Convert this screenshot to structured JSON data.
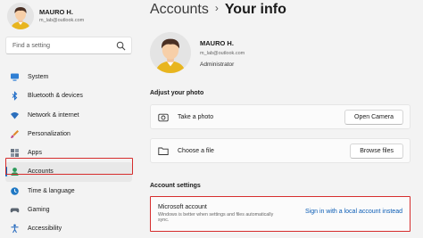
{
  "user": {
    "name": "MAURO H.",
    "email": "m_lab@outlook.com",
    "role": "Administrator"
  },
  "search": {
    "placeholder": "Find a setting"
  },
  "sidebar": {
    "items": [
      {
        "label": "System",
        "icon": "monitor-icon"
      },
      {
        "label": "Bluetooth & devices",
        "icon": "bluetooth-icon"
      },
      {
        "label": "Network & internet",
        "icon": "wifi-icon"
      },
      {
        "label": "Personalization",
        "icon": "brush-icon"
      },
      {
        "label": "Apps",
        "icon": "apps-icon"
      },
      {
        "label": "Accounts",
        "icon": "person-icon",
        "active": true
      },
      {
        "label": "Time & language",
        "icon": "globe-clock-icon"
      },
      {
        "label": "Gaming",
        "icon": "controller-icon"
      },
      {
        "label": "Accessibility",
        "icon": "accessibility-icon"
      }
    ]
  },
  "breadcrumb": {
    "parent": "Accounts",
    "separator": "›",
    "current": "Your info"
  },
  "photo_section": {
    "title": "Adjust your photo",
    "take_photo": {
      "label": "Take a photo",
      "button": "Open Camera",
      "icon": "camera-icon"
    },
    "choose_file": {
      "label": "Choose a file",
      "button": "Browse files",
      "icon": "folder-icon"
    }
  },
  "account_settings": {
    "title": "Account settings",
    "microsoft_account": {
      "title": "Microsoft account",
      "description": "Windows is better when settings and files automatically sync.",
      "link": "Sign in with a local account instead"
    }
  },
  "colors": {
    "accent": "#0067c0",
    "link": "#0a5cb5",
    "highlight": "#d62d2d"
  }
}
